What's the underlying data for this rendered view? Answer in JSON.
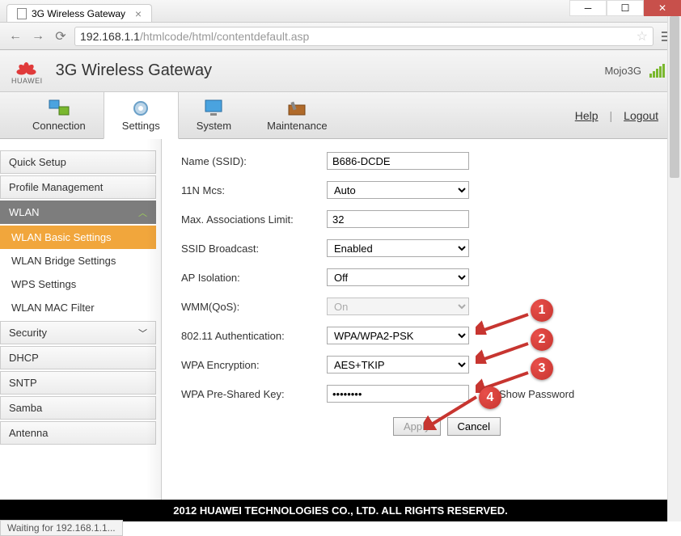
{
  "window": {
    "tab_title": "3G Wireless Gateway",
    "url_ip": "192.168.1.1",
    "url_rest": "/htmlcode/html/contentdefault.asp",
    "status_text": "Waiting for 192.168.1.1..."
  },
  "header": {
    "logo_brand": "HUAWEI",
    "title": "3G Wireless Gateway",
    "account": "Mojo3G"
  },
  "nav": {
    "tabs": [
      {
        "label": "Connection"
      },
      {
        "label": "Settings"
      },
      {
        "label": "System"
      },
      {
        "label": "Maintenance"
      }
    ],
    "help": "Help",
    "logout": "Logout"
  },
  "sidebar": {
    "groups": [
      {
        "label": "Quick Setup"
      },
      {
        "label": "Profile Management"
      },
      {
        "label": "WLAN",
        "expanded": true,
        "items": [
          {
            "label": "WLAN Basic Settings",
            "active": true
          },
          {
            "label": "WLAN Bridge Settings"
          },
          {
            "label": "WPS Settings"
          },
          {
            "label": "WLAN MAC Filter"
          }
        ]
      },
      {
        "label": "Security"
      },
      {
        "label": "DHCP"
      },
      {
        "label": "SNTP"
      },
      {
        "label": "Samba"
      },
      {
        "label": "Antenna"
      }
    ]
  },
  "form": {
    "ssid_label": "Name (SSID):",
    "ssid_value": "B686-DCDE",
    "mcs_label": "11N Mcs:",
    "mcs_value": "Auto",
    "assoc_label": "Max. Associations Limit:",
    "assoc_value": "32",
    "broadcast_label": "SSID Broadcast:",
    "broadcast_value": "Enabled",
    "apiso_label": "AP Isolation:",
    "apiso_value": "Off",
    "wmm_label": "WMM(QoS):",
    "wmm_value": "On",
    "auth_label": "802.11 Authentication:",
    "auth_value": "WPA/WPA2-PSK",
    "enc_label": "WPA Encryption:",
    "enc_value": "AES+TKIP",
    "psk_label": "WPA Pre-Shared Key:",
    "psk_value": "••••••••",
    "show_pwd_label": "Show Password",
    "apply_label": "Apply",
    "cancel_label": "Cancel"
  },
  "annotations": [
    "1",
    "2",
    "3",
    "4"
  ],
  "footer": "2012 HUAWEI TECHNOLOGIES CO., LTD. ALL RIGHTS RESERVED."
}
